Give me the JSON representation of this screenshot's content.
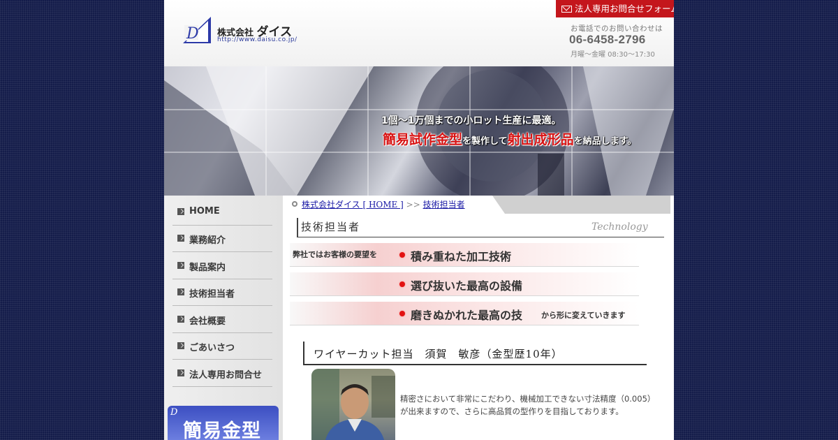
{
  "header": {
    "company_name_prefix": "株式会社",
    "company_name_main": "ダイス",
    "company_url": "http://www.daisu.co.jp/",
    "logo_letter": "D",
    "contact_button": "法人専用お問合せフォーム",
    "tel_caption": "お電話でのお問い合わせは",
    "tel_number": "06-6458-2796",
    "tel_hours": "月曜〜金曜 08:30〜17:30"
  },
  "banner": {
    "line1": "1個〜1万個までの小ロット生産に最適。",
    "line2_red1": "簡易試作金型",
    "line2_mid": "を製作して",
    "line2_red2": "射出成形品",
    "line2_end": "を納品します。"
  },
  "sidebar": {
    "items": [
      {
        "label": "HOME"
      },
      {
        "label": "業務紹介"
      },
      {
        "label": "製品案内"
      },
      {
        "label": "技術担当者"
      },
      {
        "label": "会社概要"
      },
      {
        "label": "ごあいさつ"
      },
      {
        "label": "法人専用お問合せ"
      }
    ],
    "banner_mark": "D",
    "banner_text": "簡易金型"
  },
  "breadcrumb": {
    "home_link": "株式会社ダイス [ HOME ]",
    "separator": ">>",
    "current": "技術担当者"
  },
  "main": {
    "title": "技術担当者",
    "title_en": "Technology",
    "intro_prefix": "弊社ではお客様の要望を",
    "points": [
      "積み重ねた加工技術",
      "選び抜いた最高の設備",
      "磨きぬかれた最高の技"
    ],
    "intro_suffix": "から形に変えていきます",
    "staff_heading": "ワイヤーカット担当　須賀　敏彦（金型歴10年）",
    "staff_text": "精密さにおいて非常にこだわり、機械加工できない寸法精度（0.005）が出来ますので、さらに高品質の型作りを目指しております。"
  },
  "colors": {
    "background": "#141c4a",
    "accent_red": "#c4161c",
    "link_blue": "#1a1aa6"
  }
}
